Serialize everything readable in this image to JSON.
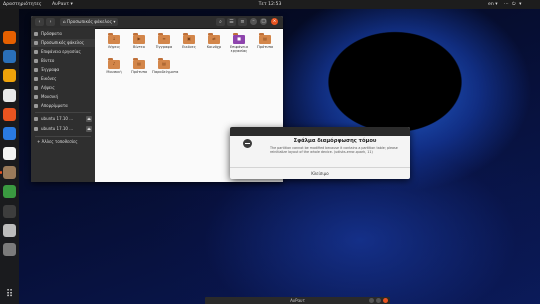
{
  "topbar": {
    "activities": "Δραστηριότητες",
    "app_name": "ΑυΡαυτ ▾",
    "clock": "Τετ 12:53",
    "language": "en ▾",
    "system_icons": "⋯ ⏻ ▾"
  },
  "dock": {
    "icons": [
      {
        "name": "firefox",
        "color": "#e66000"
      },
      {
        "name": "thunderbird",
        "color": "#2a6fb8"
      },
      {
        "name": "rhythmbox",
        "color": "#f0a30a"
      },
      {
        "name": "libreoffice",
        "color": "#e8e8e8"
      },
      {
        "name": "software",
        "color": "#e95420"
      },
      {
        "name": "help",
        "color": "#2a7ae2"
      },
      {
        "name": "text-editor",
        "color": "#f2f2f2"
      },
      {
        "name": "files",
        "color": "#9a7a5a"
      },
      {
        "name": "chrome",
        "color": "#3a9a40"
      },
      {
        "name": "terminal",
        "color": "#3d3d3d"
      },
      {
        "name": "screenshot",
        "color": "#bcbcbc"
      },
      {
        "name": "disks",
        "color": "#7b7b7b"
      }
    ],
    "apps_glyph": "⠿"
  },
  "files_window": {
    "nav_back": "‹",
    "nav_forward": "›",
    "breadcrumb": "⌂ Προσωπικός φάκελος ▾",
    "controls": {
      "search": "⌕",
      "view": "☰",
      "menu": "≡",
      "minimize": "–",
      "maximize": "□",
      "close": "×"
    },
    "sidebar": [
      {
        "label": "Πρόσφατα"
      },
      {
        "label": "Προσωπικός φάκελος"
      },
      {
        "label": "Επιφάνεια εργασίας"
      },
      {
        "label": "Βίντεο"
      },
      {
        "label": "Έγγραφα"
      },
      {
        "label": "Εικόνες"
      },
      {
        "label": "Λήψεις"
      },
      {
        "label": "Μουσική"
      },
      {
        "label": "Απορρίμματα"
      },
      {
        "label": "ubuntu 17.10 ..."
      },
      {
        "label": "ubuntu 17.10 ..."
      },
      {
        "label": "+ Άλλες τοποθεσίες"
      }
    ],
    "folders": [
      {
        "label": "Λήψεις",
        "symbol": "↓"
      },
      {
        "label": "Βίντεο",
        "symbol": "▶"
      },
      {
        "label": "Έγγραφα",
        "symbol": "≡"
      },
      {
        "label": "Εικόνες",
        "symbol": "▣"
      },
      {
        "label": "Κοινόχρ",
        "symbol": "⇄"
      },
      {
        "label": "Επιφάνεια εργασίας",
        "symbol": "■"
      },
      {
        "label": "Πρότυπα",
        "symbol": "▤"
      },
      {
        "label": "Μουσική",
        "symbol": "♪"
      },
      {
        "label": "Πρότυπα",
        "symbol": "▤"
      },
      {
        "label": "Παραδείγματα",
        "symbol": "▤"
      }
    ]
  },
  "dialog": {
    "title": "Σφάλμα διαμόρφωσης τόμου",
    "message": "The partition cannot be modified because it contains a partition table; please reinitialize layout of the whole device. (udisks-error-quark, 11)",
    "button": "Κλείσιμο"
  },
  "taskbar": {
    "title": "ΑυΡαυτ"
  }
}
